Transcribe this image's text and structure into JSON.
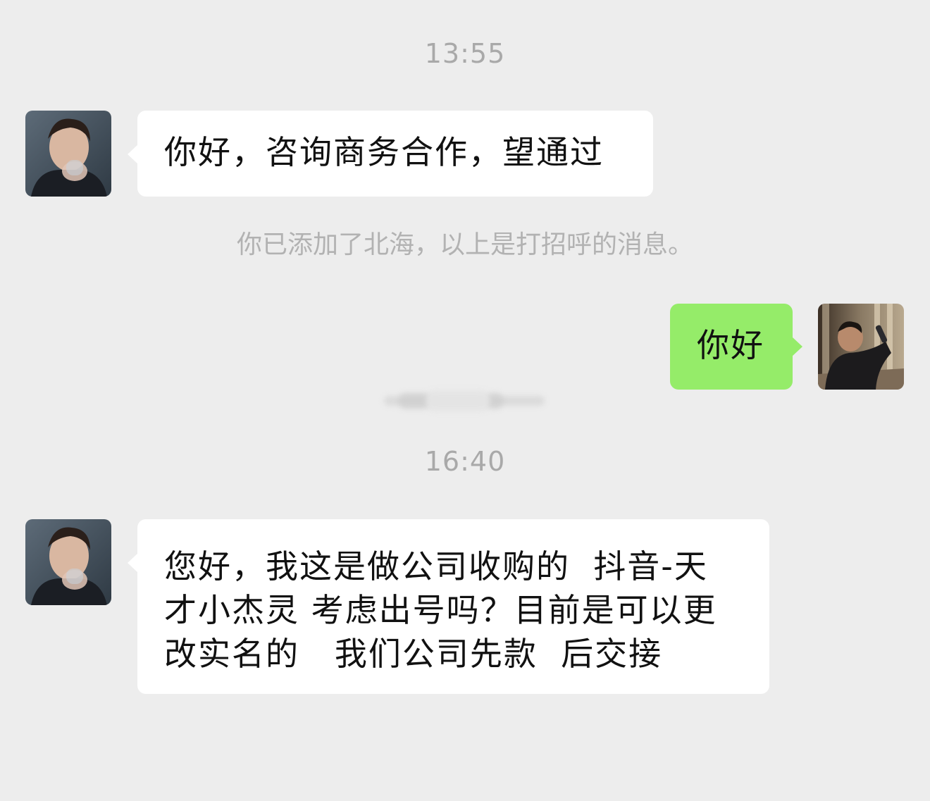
{
  "chat": {
    "timestamp_1": "13:55",
    "timestamp_2": "16:40",
    "system_note": "你已添加了北海，以上是打招呼的消息。",
    "messages": [
      {
        "sender": "contact",
        "text": "你好，咨询商务合作，望通过"
      },
      {
        "sender": "self",
        "text": "你好"
      },
      {
        "sender": "contact",
        "text": "您好，我这是做公司收购的  抖音-天\n才小杰灵 考虑出号吗？目前是可以更\n改实名的   我们公司先款  后交接"
      }
    ]
  },
  "colors": {
    "background": "#ededed",
    "incoming_bubble": "#ffffff",
    "outgoing_bubble": "#95ec69",
    "timestamp_text": "#a9a9a9",
    "system_text": "#b2b2b2",
    "message_text": "#111111"
  },
  "icons": {
    "contact_avatar": "contact-avatar-photo",
    "self_avatar": "self-avatar-photo"
  }
}
